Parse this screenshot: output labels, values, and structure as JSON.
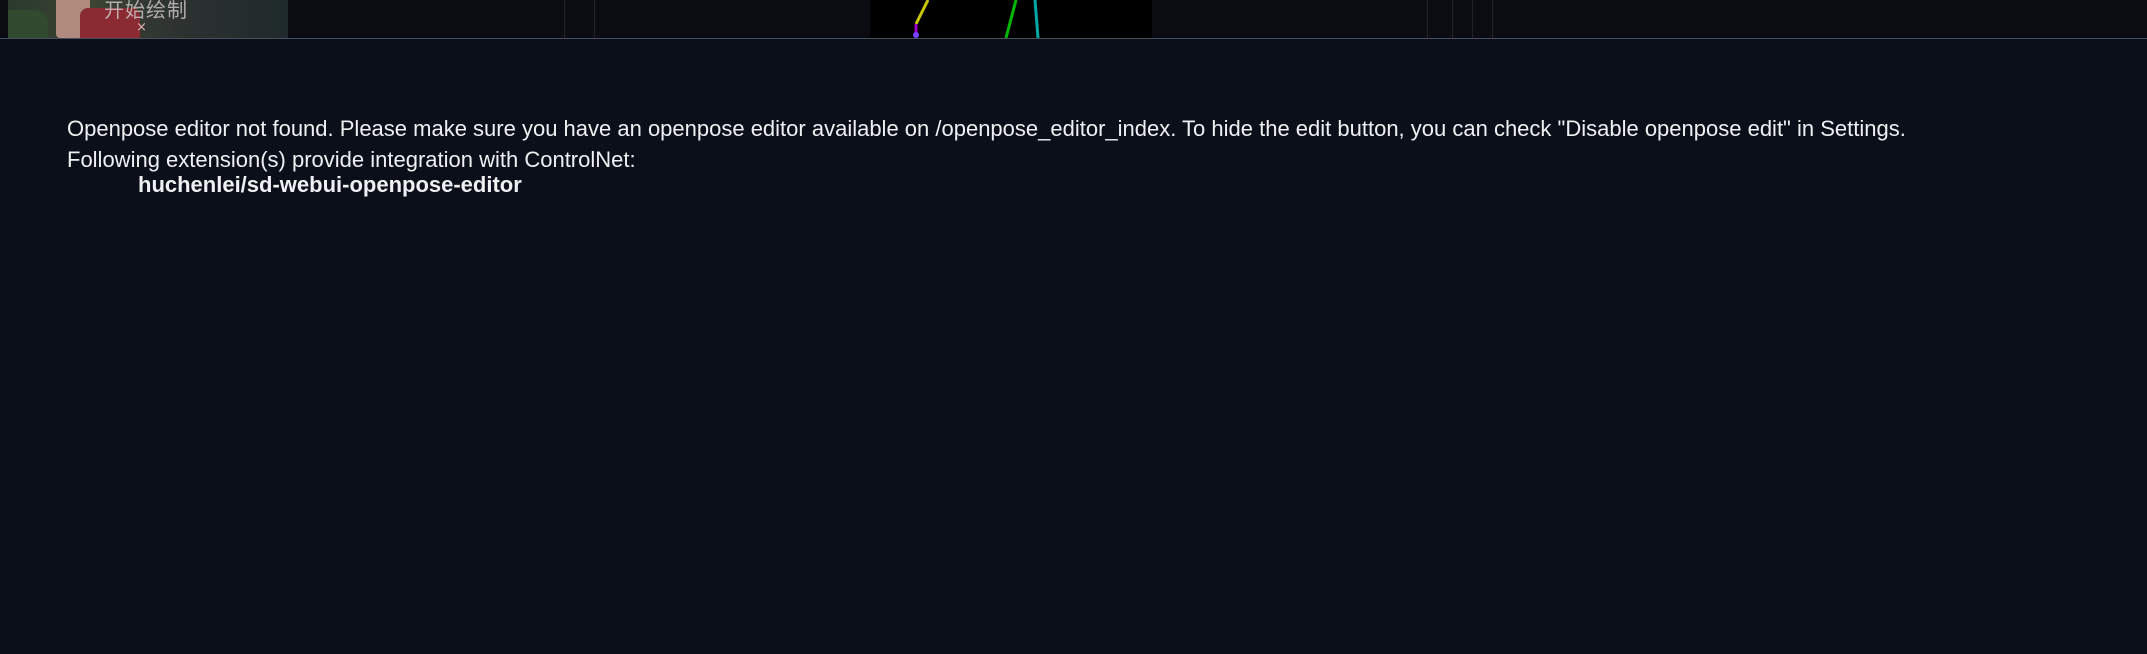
{
  "thumbnail": {
    "overlay_text": "开始绘制",
    "close_glyph": "×"
  },
  "notice": {
    "editor_not_found": "Openpose editor not found. Please make sure you have an openpose editor available on /openpose_editor_index. To hide the edit button, you can check \"Disable openpose edit\" in Settings.",
    "integration_heading": "Following extension(s) provide integration with ControlNet:",
    "extensions": [
      "huchenlei/sd-webui-openpose-editor"
    ]
  },
  "colors": {
    "background": "#0b0f19",
    "text": "#eef0f4",
    "divider": "#4a4f5c"
  }
}
